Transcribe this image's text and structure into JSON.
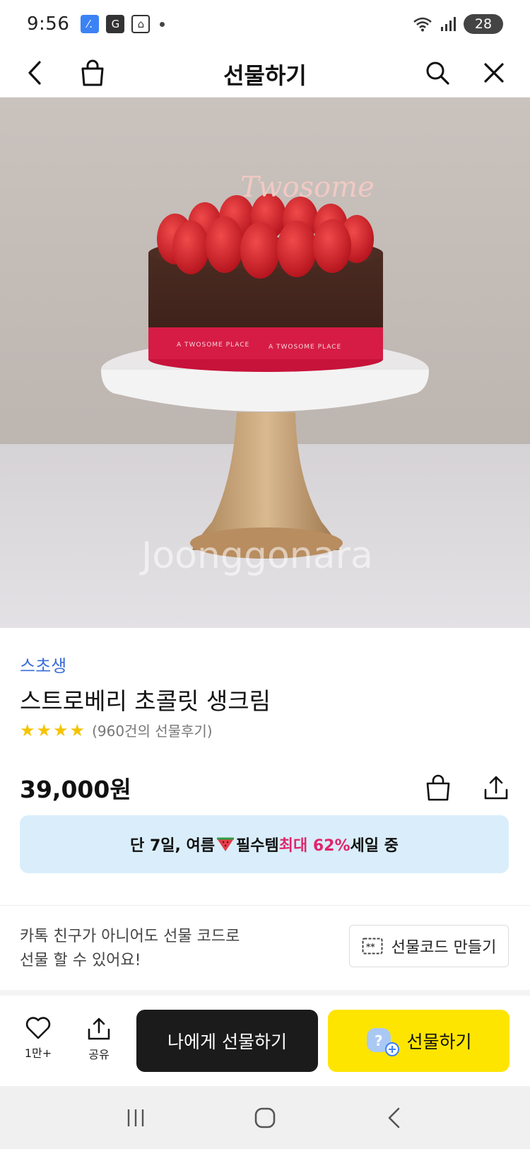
{
  "status_bar": {
    "time": "9:56",
    "badges": [
      "⁄.",
      "G",
      "⌂"
    ],
    "battery": "28"
  },
  "nav": {
    "title": "선물하기",
    "back_icon": "chevron-left-icon",
    "bag_icon": "shopping-bag-icon",
    "search_icon": "search-icon",
    "close_icon": "close-icon"
  },
  "hero": {
    "topper_text": "Twosome",
    "ribbon_text_left": "A TWOSOME PLACE",
    "ribbon_text_right": "A TWOSOME PLACE",
    "watermark": "Joonggonara"
  },
  "product": {
    "brand": "스초생",
    "name": "스트로베리 초콜릿 생크림",
    "rating_stars": 4,
    "review_text": "(960건의 선물후기)",
    "price": "39,000원"
  },
  "promo": {
    "text_before": "단 7일, 여름",
    "text_middle": "필수템 ",
    "highlight": "최대 62%",
    "text_after": "세일 중"
  },
  "gift_code": {
    "line1": "카톡 친구가 아니어도 선물 코드로",
    "line2": "선물 할 수 있어요!",
    "button_label": "선물코드 만들기"
  },
  "actions": {
    "like_count": "1만+",
    "share_label": "공유",
    "self_gift_label": "나에게 선물하기",
    "gift_label": "선물하기"
  },
  "colors": {
    "brand_blue": "#3a6dd8",
    "kakao_yellow": "#fee500",
    "promo_bg": "#d9eefa",
    "promo_highlight": "#e0266c",
    "star": "#f5c400"
  }
}
